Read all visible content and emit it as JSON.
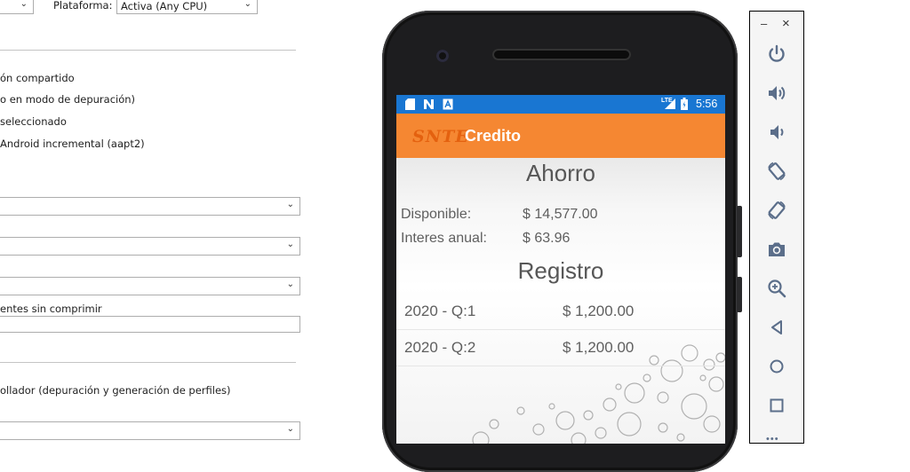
{
  "vs": {
    "platform_label": "Plataforma:",
    "platform_value": "Activa (Any CPU)",
    "options": [
      "ón compartido",
      "o en modo de depuración)",
      "seleccionado",
      "Android incremental (aapt2)"
    ],
    "uncompressed_label": "entes sin comprimir",
    "uncompressed_value": "",
    "developer_label": "ollador (depuración y generación de perfiles)"
  },
  "phone": {
    "status": {
      "time": "5:56",
      "network": "LTE"
    },
    "app_title": "Credito",
    "logo_text": "SNTE",
    "ahorro": {
      "heading": "Ahorro",
      "rows": [
        {
          "label": "Disponible:",
          "value": "$ 14,577.00"
        },
        {
          "label": "Interes anual:",
          "value": "$ 63.96"
        }
      ]
    },
    "registro": {
      "heading": "Registro",
      "items": [
        {
          "period": "2020 - Q:1",
          "amount": "$ 1,200.00"
        },
        {
          "period": "2020 - Q:2",
          "amount": "$ 1,200.00"
        }
      ]
    }
  },
  "emulator": {
    "minimize": "–",
    "close": "×",
    "more": "•••",
    "tools": [
      "power-icon",
      "volume-up-icon",
      "volume-down-icon",
      "rotate-left-icon",
      "rotate-right-icon",
      "camera-icon",
      "zoom-icon",
      "back-icon",
      "home-icon",
      "overview-icon"
    ]
  },
  "colors": {
    "status_bar": "#1976d2",
    "app_bar": "#f58732",
    "text": "#555555"
  }
}
